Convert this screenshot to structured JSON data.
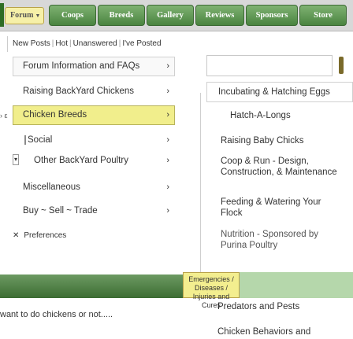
{
  "nav": {
    "forum_label": "Forum",
    "tabs": [
      "Coops",
      "Breeds",
      "Gallery",
      "Reviews",
      "Sponsors",
      "Store"
    ]
  },
  "sublinks": [
    "New Posts",
    "Hot",
    "Unanswered",
    "I've Posted"
  ],
  "left_menu": [
    {
      "label": "Forum Information and FAQs"
    },
    {
      "label": "Raising BackYard Chickens"
    },
    {
      "label": "Chicken Breeds"
    },
    {
      "label": "Social"
    },
    {
      "label": "Other BackYard Poultry"
    },
    {
      "label": "Miscellaneous"
    },
    {
      "label": "Buy ~ Sell ~ Trade"
    }
  ],
  "preferences_label": "Preferences",
  "right_menu": [
    "Incubating & Hatching Eggs",
    "Hatch-A-Longs",
    "Raising Baby Chicks",
    "Coop & Run - Design, Construction, & Maintenance",
    "Feeding & Watering Your Flock",
    "Nutrition - Sponsored by Purina Poultry",
    "Emergencies / Diseases / Injuries and Cures",
    "Predators and Pests",
    "Chicken Behaviors and"
  ],
  "bottom_text": "want to do chickens or not.....",
  "colors": {
    "nav_green": "#4a8440",
    "highlight_yellow": "#f1ee8c"
  }
}
